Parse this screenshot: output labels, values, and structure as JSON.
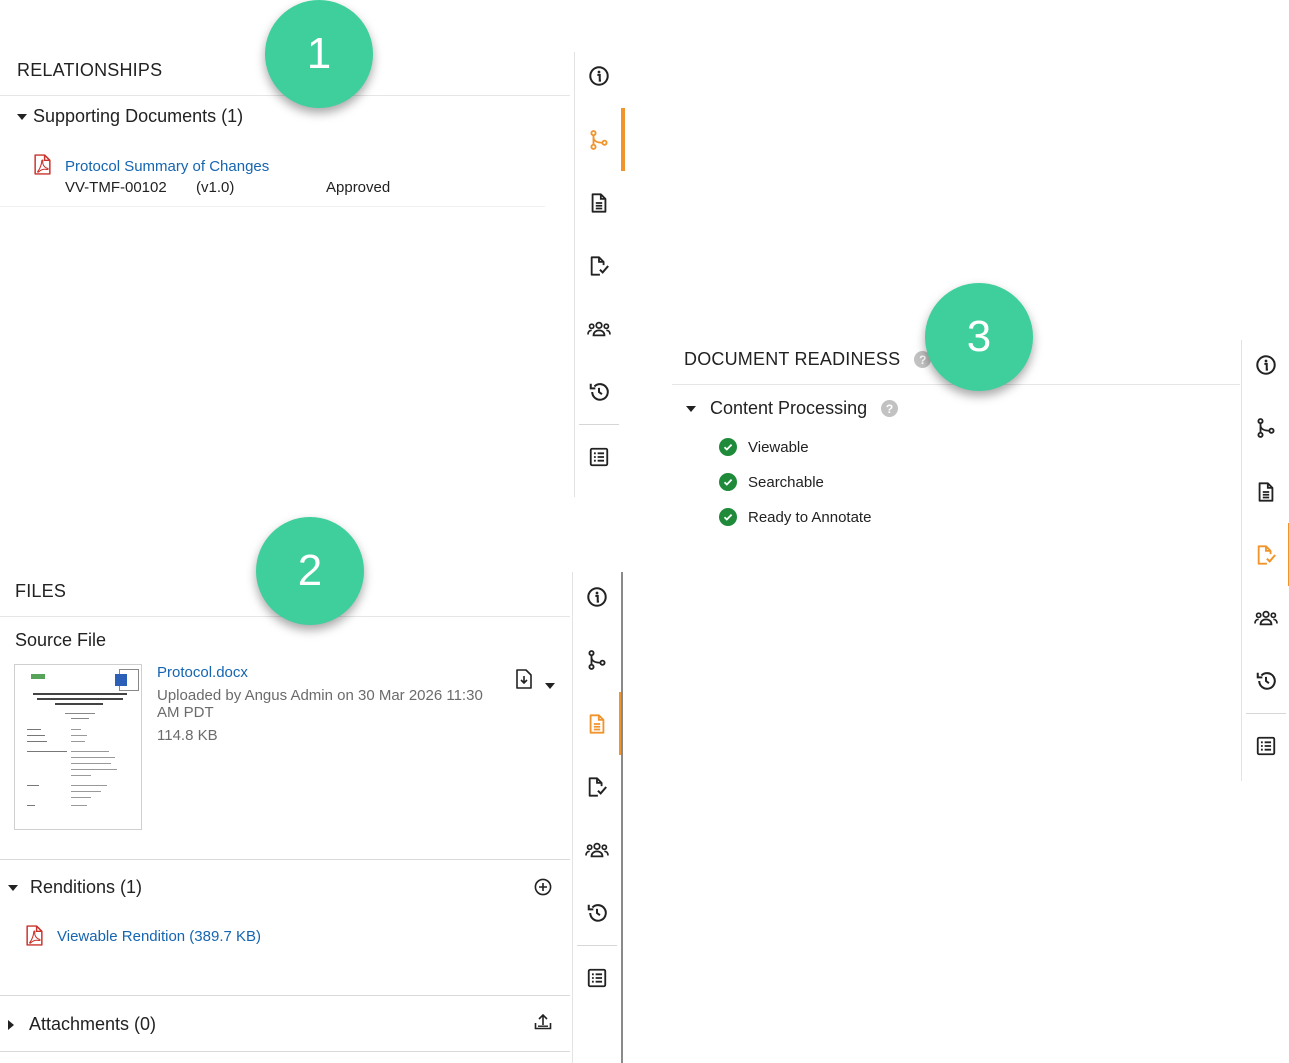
{
  "callouts": {
    "one": "1",
    "two": "2",
    "three": "3"
  },
  "relationships": {
    "title": "RELATIONSHIPS",
    "group_label": "Supporting Documents (1)",
    "doc": {
      "name": "Protocol Summary of Changes",
      "number": "VV-TMF-00102",
      "version": "(v1.0)",
      "status": "Approved"
    }
  },
  "files": {
    "title": "FILES",
    "source_label": "Source File",
    "file_name": "Protocol.docx",
    "uploaded": "Uploaded by Angus Admin on 30 Mar 2026 11:30 AM PDT",
    "size": "114.8 KB",
    "renditions_label": "Renditions (1)",
    "rendition_link": "Viewable Rendition (389.7 KB)",
    "attachments_label": "Attachments (0)"
  },
  "readiness": {
    "title": "DOCUMENT READINESS",
    "group_label": "Content Processing",
    "items": [
      "Viewable",
      "Searchable",
      "Ready to Annotate"
    ]
  },
  "rail_icons": [
    "info-icon",
    "relationships-icon",
    "file-icon",
    "checklist-icon",
    "people-icon",
    "history-icon",
    "list-icon"
  ],
  "colors": {
    "accent": "#f0942b",
    "link": "#1565b0",
    "success": "#1f8a3a",
    "callout": "#3ecf9c",
    "pdf": "#c8332b"
  }
}
